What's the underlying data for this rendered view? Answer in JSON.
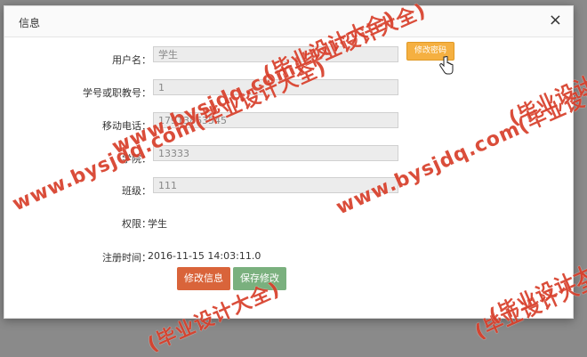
{
  "dialog": {
    "title": "信息",
    "close_glyph": "×"
  },
  "form": {
    "username": {
      "label": "用户名：",
      "value": "学生"
    },
    "student_id": {
      "label": "学号或职教号：",
      "value": "1"
    },
    "phone": {
      "label": "移动电话：",
      "value": "17913863545"
    },
    "college": {
      "label": "学院：",
      "value": "13333"
    },
    "class": {
      "label": "班级：",
      "value": "111"
    },
    "permission": {
      "label": "权限：",
      "value": "学生"
    },
    "register_time": {
      "label": "注册时间：",
      "value": "2016-11-15 14:03:11.0"
    }
  },
  "buttons": {
    "change_password": "修改密码",
    "edit_info": "修改信息",
    "save_changes": "保存修改"
  },
  "watermark": {
    "text_long": "www.bysjdq.com(毕业设计大全)",
    "text_short": "(毕业设计大全)",
    "color": "#d8402c"
  },
  "icons": {
    "cursor": "hand-pointer-icon"
  }
}
